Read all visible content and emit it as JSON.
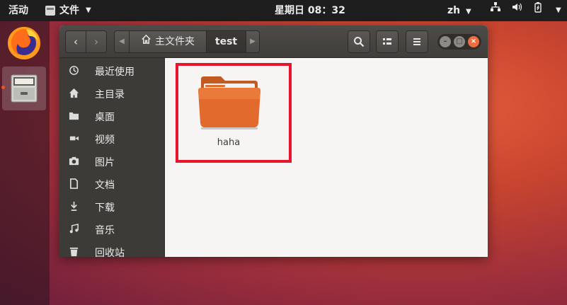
{
  "topbar": {
    "activities": "活动",
    "app_menu": "文件",
    "clock": "星期日 08：32",
    "language": "zh"
  },
  "dock": {
    "items": [
      {
        "name": "firefox-icon"
      },
      {
        "name": "files-icon",
        "running": true
      }
    ]
  },
  "toolbar": {
    "back": "‹",
    "forward": "›",
    "path_home": "主文件夹",
    "path_current": "test"
  },
  "sidebar": {
    "items": [
      {
        "label": "最近使用",
        "icon": "clock-icon"
      },
      {
        "label": "主目录",
        "icon": "home-icon"
      },
      {
        "label": "桌面",
        "icon": "folder-icon"
      },
      {
        "label": "视频",
        "icon": "video-icon"
      },
      {
        "label": "图片",
        "icon": "camera-icon"
      },
      {
        "label": "文档",
        "icon": "document-icon"
      },
      {
        "label": "下载",
        "icon": "download-icon"
      },
      {
        "label": "音乐",
        "icon": "music-icon"
      },
      {
        "label": "回收站",
        "icon": "trash-icon"
      }
    ]
  },
  "content": {
    "files": [
      {
        "name": "haha",
        "type": "folder"
      }
    ]
  },
  "colors": {
    "accent": "#e95420",
    "folder": "#e26a2c",
    "highlight": "#e8142c"
  }
}
